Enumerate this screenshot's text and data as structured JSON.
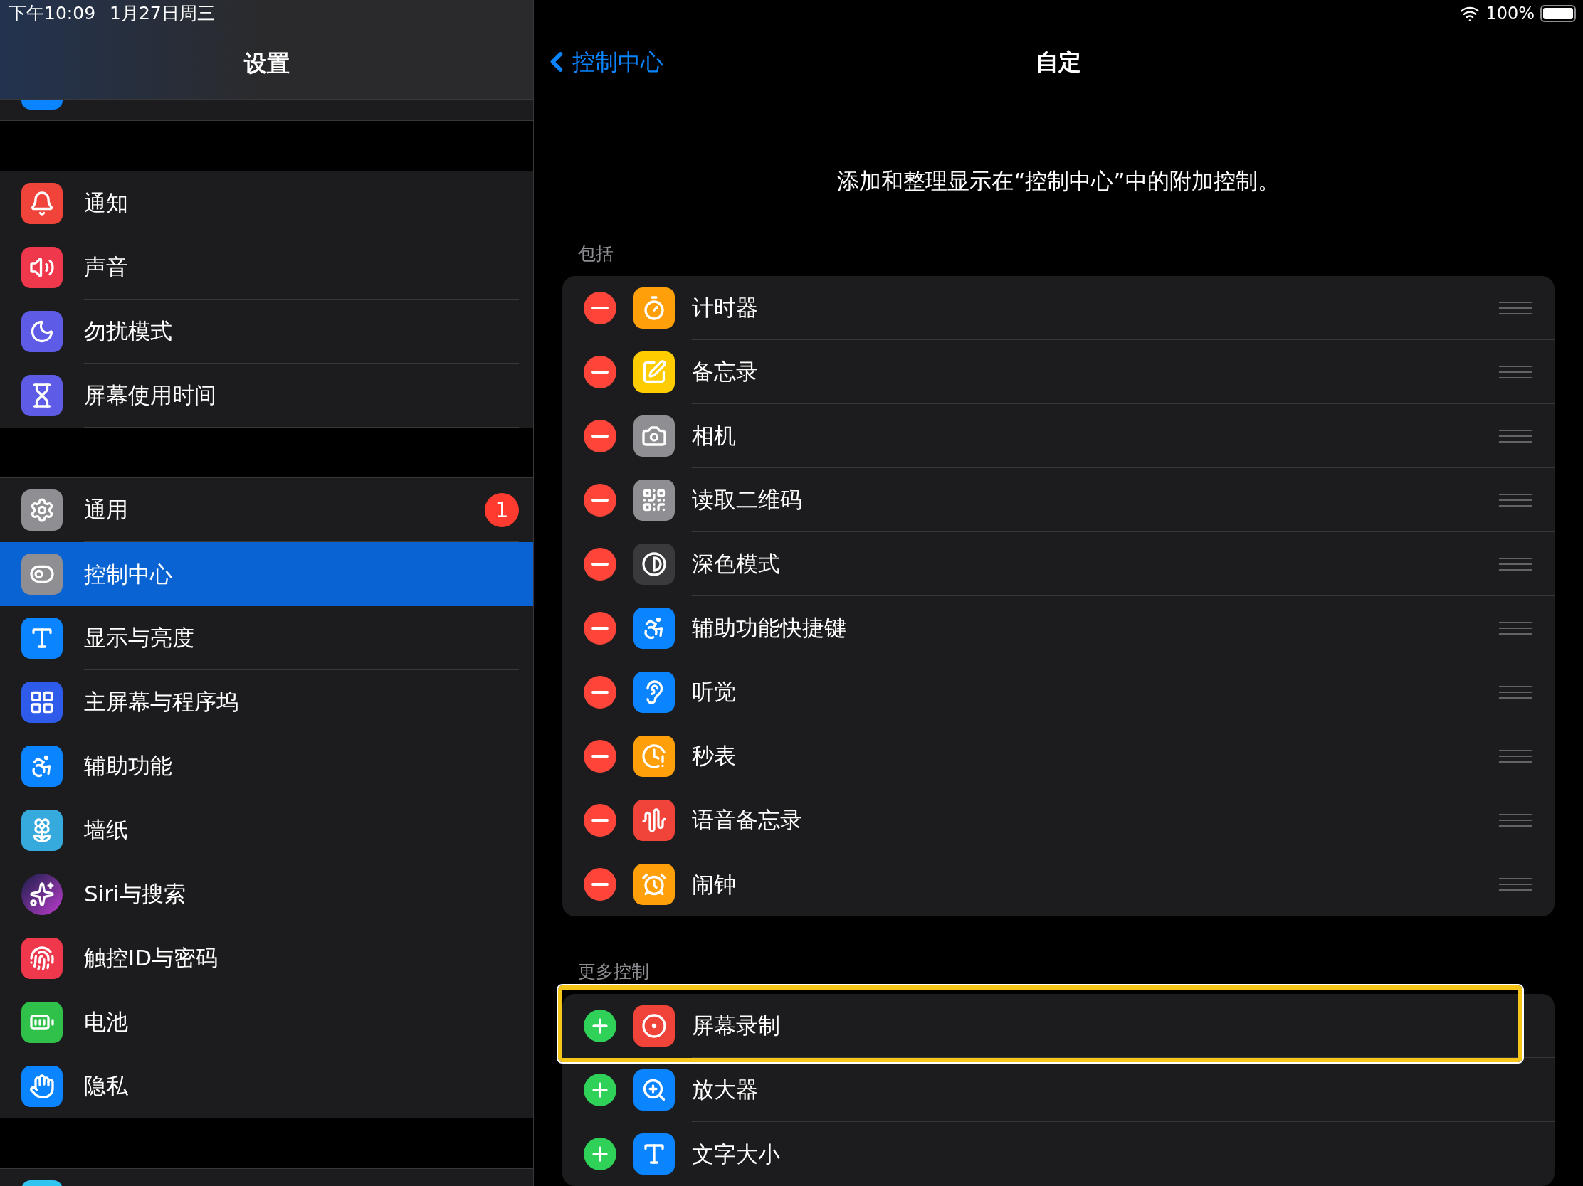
{
  "status_bar": {
    "time": "下午10:09",
    "date": "1月27日周三",
    "battery": "100%"
  },
  "sidebar": {
    "title": "设置",
    "groups": [
      {
        "items": [
          {
            "label": "通知",
            "selected": false
          },
          {
            "label": "声音",
            "selected": false
          },
          {
            "label": "勿扰模式",
            "selected": false
          },
          {
            "label": "屏幕使用时间",
            "selected": false
          }
        ]
      },
      {
        "items": [
          {
            "label": "通用",
            "selected": false,
            "badge": "1"
          },
          {
            "label": "控制中心",
            "selected": true
          },
          {
            "label": "显示与亮度",
            "selected": false
          },
          {
            "label": "主屏幕与程序坞",
            "selected": false
          },
          {
            "label": "辅助功能",
            "selected": false
          },
          {
            "label": "墙纸",
            "selected": false
          },
          {
            "label": "Siri与搜索",
            "selected": false
          },
          {
            "label": "触控ID与密码",
            "selected": false
          },
          {
            "label": "电池",
            "selected": false
          },
          {
            "label": "隐私",
            "selected": false
          }
        ]
      }
    ]
  },
  "detail": {
    "back": "控制中心",
    "title": "自定",
    "description": "添加和整理显示在“控制中心”中的附加控制。",
    "sections": [
      {
        "label": "包括",
        "kind": "remove",
        "items": [
          {
            "label": "计时器",
            "highlighted": false
          },
          {
            "label": "备忘录",
            "highlighted": false
          },
          {
            "label": "相机",
            "highlighted": false
          },
          {
            "label": "读取二维码",
            "highlighted": false
          },
          {
            "label": "深色模式",
            "highlighted": false
          },
          {
            "label": "辅助功能快捷键",
            "highlighted": false
          },
          {
            "label": "听觉",
            "highlighted": false
          },
          {
            "label": "秒表",
            "highlighted": false
          },
          {
            "label": "语音备忘录",
            "highlighted": false
          },
          {
            "label": "闹钟",
            "highlighted": false
          }
        ]
      },
      {
        "label": "更多控制",
        "kind": "add",
        "items": [
          {
            "label": "屏幕录制",
            "highlighted": true
          },
          {
            "label": "放大器",
            "highlighted": false
          },
          {
            "label": "文字大小",
            "highlighted": false
          }
        ]
      }
    ]
  }
}
